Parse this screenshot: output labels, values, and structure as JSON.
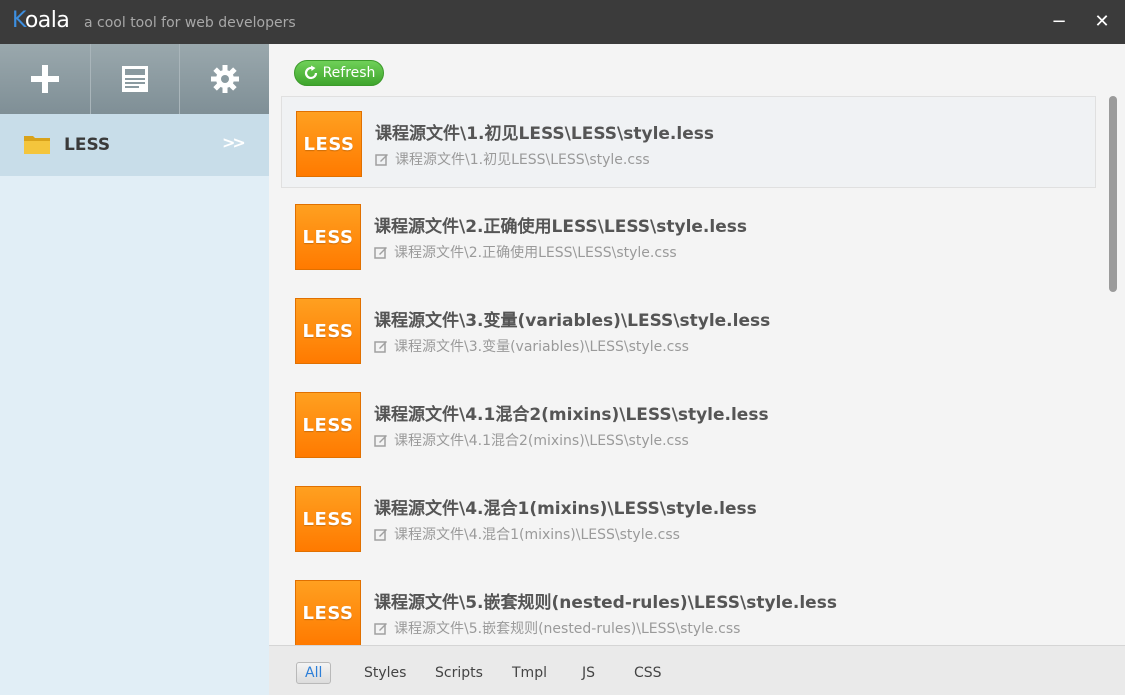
{
  "window": {
    "app_name_first": "K",
    "app_name_rest": "oala",
    "tagline": "a cool tool for web developers",
    "minimize_label": "−",
    "close_label": "✕"
  },
  "toolbar": {
    "add_icon": "plus-icon",
    "log_icon": "log-icon",
    "settings_icon": "gear-icon"
  },
  "sidebar": {
    "projects": [
      {
        "label": "LESS",
        "arrow": ">>"
      }
    ]
  },
  "main": {
    "refresh_label": "Refresh",
    "files": [
      {
        "badge": "LESS",
        "title": "课程源文件\\1.初见LESS\\LESS\\style.less",
        "output": "课程源文件\\1.初见LESS\\LESS\\style.css"
      },
      {
        "badge": "LESS",
        "title": "课程源文件\\2.正确使用LESS\\LESS\\style.less",
        "output": "课程源文件\\2.正确使用LESS\\LESS\\style.css"
      },
      {
        "badge": "LESS",
        "title": "课程源文件\\3.变量(variables)\\LESS\\style.less",
        "output": "课程源文件\\3.变量(variables)\\LESS\\style.css"
      },
      {
        "badge": "LESS",
        "title": "课程源文件\\4.1混合2(mixins)\\LESS\\style.less",
        "output": "课程源文件\\4.1混合2(mixins)\\LESS\\style.css"
      },
      {
        "badge": "LESS",
        "title": "课程源文件\\4.混合1(mixins)\\LESS\\style.less",
        "output": "课程源文件\\4.混合1(mixins)\\LESS\\style.css"
      },
      {
        "badge": "LESS",
        "title": "课程源文件\\5.嵌套规则(nested-rules)\\LESS\\style.less",
        "output": "课程源文件\\5.嵌套规则(nested-rules)\\LESS\\style.css"
      }
    ],
    "filter_tabs": [
      "All",
      "Styles",
      "Scripts",
      "Tmpl",
      "JS",
      "CSS"
    ],
    "active_filter": "All"
  },
  "colors": {
    "titlebar": "#3b3b3b",
    "accent_blue": "#3d8fe0",
    "less_orange": "#ff8c00",
    "refresh_green": "#4cb83a",
    "sidebar_bg": "#e1eef6"
  }
}
